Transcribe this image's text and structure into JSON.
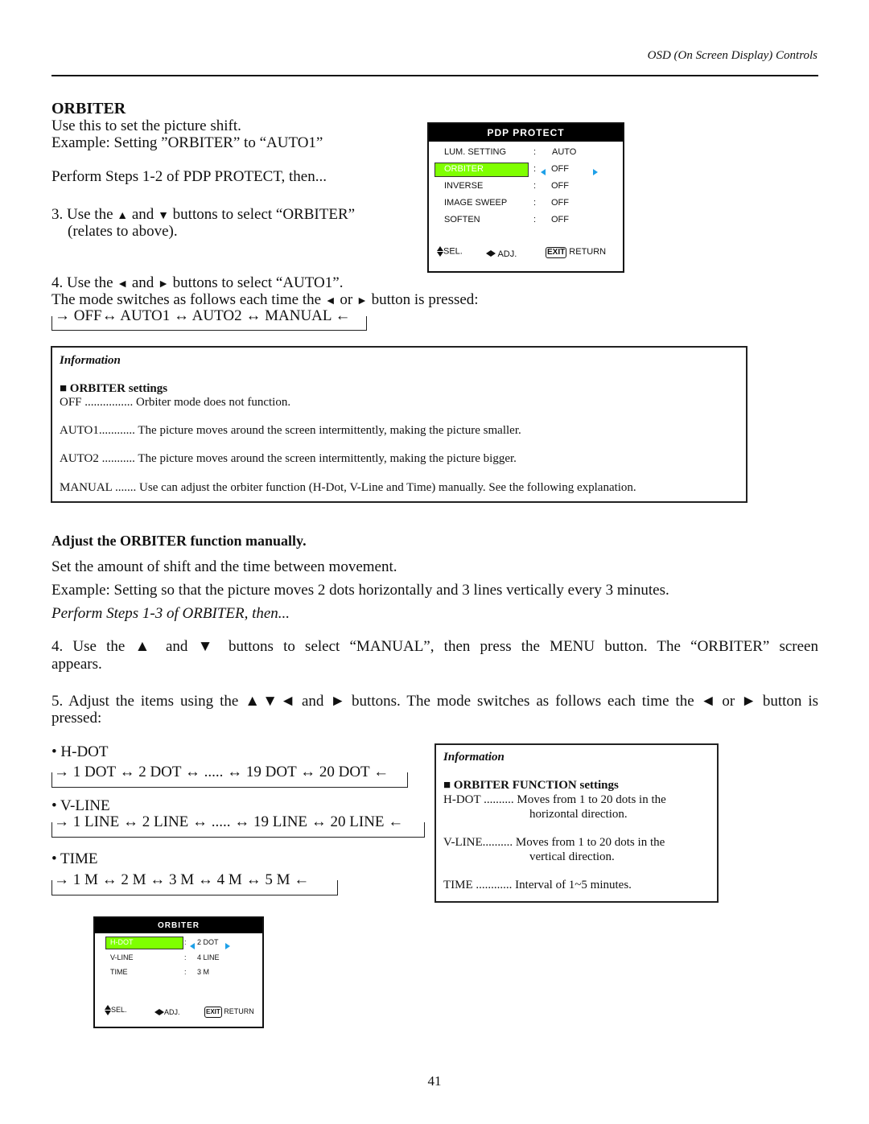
{
  "header": {
    "title": "OSD (On Screen Display) Controls"
  },
  "section1": {
    "heading": "ORBITER",
    "lines": [
      "Use this to set the picture shift.",
      "Example: Setting ”ORBITER” to “AUTO1”",
      "Perform Steps 1-2 of PDP PROTECT, then..."
    ],
    "step3": {
      "prefix": "3. Use the ",
      "up": "▲",
      "mid": " and ",
      "down": "▼",
      "suffix": " buttons to select “ORBITER”",
      "line2": "(relates to above)."
    },
    "step4": {
      "prefix": "4. Use the ",
      "left": "◄",
      "mid": " and ",
      "right": "►",
      "suffix": " buttons to select “AUTO1”."
    },
    "mode_line": {
      "prefix": "The mode switches as follows each time the ",
      "left": "◄",
      "mid": " or ",
      "right": "►",
      "suffix": " button is pressed:"
    },
    "sequence": "→ OFF↔ AUTO1 ↔ AUTO2 ↔ MANUAL ←"
  },
  "osd_pdp_protect": {
    "title": "PDP PROTECT",
    "items": [
      {
        "label": "LUM. SETTING",
        "sep": ":",
        "value": "AUTO",
        "selected": false
      },
      {
        "label": "ORBITER",
        "sep": ":",
        "value": "OFF",
        "selected": true
      },
      {
        "label": "INVERSE",
        "sep": ":",
        "value": "OFF",
        "selected": false
      },
      {
        "label": "IMAGE SWEEP",
        "sep": ":",
        "value": "OFF",
        "selected": false
      },
      {
        "label": "SOFTEN",
        "sep": ":",
        "value": "OFF",
        "selected": false
      }
    ],
    "footer": {
      "sel": "SEL.",
      "adj": "ADJ.",
      "exit": "EXIT",
      "return": "RETURN"
    },
    "highlight_color": "#7fff00",
    "arrow_color": "#1ea0e8"
  },
  "info_box_1": {
    "title": "Information",
    "subtitle": "■ ORBITER settings",
    "rows": [
      {
        "key": "OFF ................",
        "desc": " Orbiter mode does not function."
      },
      {
        "key": "AUTO1............",
        "desc": " The picture moves around the screen intermittently, making the picture smaller."
      },
      {
        "key": "AUTO2 ...........",
        "desc": " The picture moves around the screen intermittently, making the picture bigger."
      },
      {
        "key": "MANUAL .......",
        "desc": " Use can adjust the orbiter function (H-Dot, V-Line and Time) manually. See the following explanation."
      }
    ]
  },
  "section2": {
    "heading": "Adjust the ORBITER function manually.",
    "line1": "Set the amount of shift and the time between movement.",
    "line2": "Example: Setting so that the picture moves 2 dots horizontally and 3 lines vertically every 3 minutes.",
    "line3": "Perform Steps 1-3 of ORBITER, then...",
    "step4_line1": "4. Use the ▲ and ▼ buttons to select “MANUAL”, then press the MENU button. The “ORBITER” screen",
    "step4_line2": "appears.",
    "step5_line1": "5. Adjust the items using the ▲▼◄ and ► buttons. The mode switches as follows each time the ◄ or ► button is",
    "step5_line2": "pressed:",
    "groups": [
      {
        "label": "• H-DOT",
        "sequence": "→ 1 DOT ↔ 2 DOT ↔ ..... ↔ 19 DOT ↔ 20 DOT ←"
      },
      {
        "label": "• V-LINE",
        "sequence": "→ 1 LINE ↔ 2 LINE ↔ ..... ↔ 19 LINE ↔ 20 LINE ←"
      },
      {
        "label": "• TIME",
        "sequence": "→ 1 M ↔ 2 M ↔ 3 M ↔ 4 M ↔ 5 M ←"
      }
    ]
  },
  "info_box_2": {
    "title": "Information",
    "subtitle": "■ ORBITER FUNCTION settings",
    "rows": [
      {
        "key": "H-DOT ..........",
        "desc": " Moves from 1 to 20 dots in the",
        "desc2": "horizontal direction."
      },
      {
        "key": "V-LINE..........",
        "desc": " Moves from 1 to 20 dots in the",
        "desc2": "vertical direction."
      },
      {
        "key": "TIME ............",
        "desc": " Interval of 1~5 minutes.",
        "desc2": ""
      }
    ]
  },
  "osd_orbiter": {
    "title": "ORBITER",
    "items": [
      {
        "label": "H-DOT",
        "sep": ":",
        "value": "2 DOT",
        "selected": true
      },
      {
        "label": "V-LINE",
        "sep": ":",
        "value": "4 LINE",
        "selected": false
      },
      {
        "label": "TIME",
        "sep": ":",
        "value": "3 M",
        "selected": false
      }
    ],
    "footer": {
      "sel": "SEL.",
      "adj": "ADJ.",
      "exit": "EXIT",
      "return": "RETURN"
    }
  },
  "page_number": "41"
}
